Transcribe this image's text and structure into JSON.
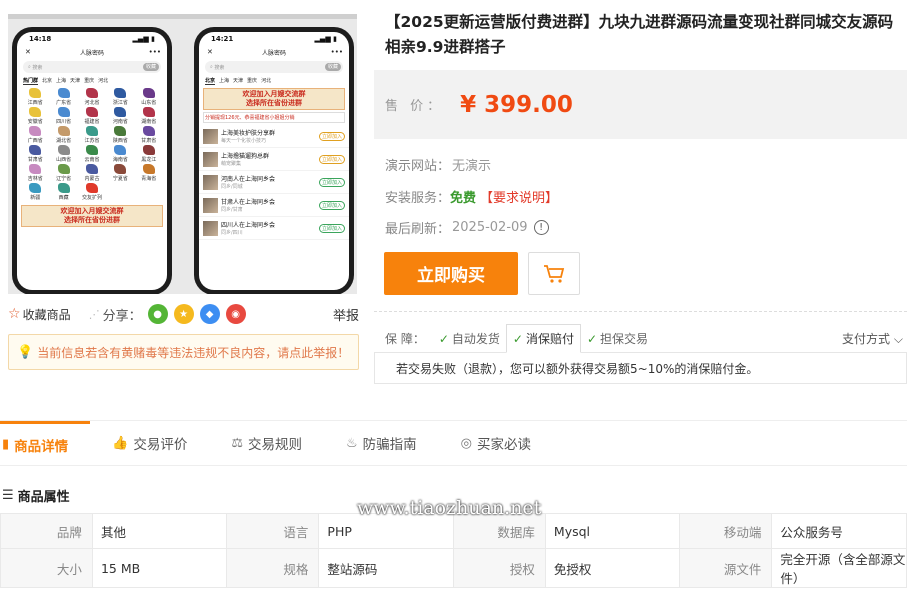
{
  "product": {
    "title": "【2025更新运营版付费进群】九块九进群源码流量变现社群同城交友源码相亲9.9进群搭子",
    "price_label": "售 价：",
    "price": "¥ 399.00",
    "demo_label": "演示网站：",
    "demo_value": "无演示",
    "install_label": "安装服务：",
    "install_value": "免费",
    "install_req": "【要求说明】",
    "refresh_label": "最后刷新：",
    "refresh_value": "2025-02-09",
    "info_icon_glyph": "!",
    "buy_label": "立即购买"
  },
  "gallery": {
    "phone1": {
      "time": "14:18",
      "title": "人脉密码",
      "search_placeholder": "搜索",
      "search_btn": "收藏",
      "cities": [
        "热门群",
        "北京",
        "上海",
        "天津",
        "重庆",
        "河北"
      ],
      "provinces": [
        {
          "name": "江西省",
          "color": "#e8c23a"
        },
        {
          "name": "广东省",
          "color": "#4a8ad0"
        },
        {
          "name": "河北省",
          "color": "#b2344a"
        },
        {
          "name": "浙江省",
          "color": "#2f5aa0"
        },
        {
          "name": "山东省",
          "color": "#6a3a8a"
        },
        {
          "name": "安徽省",
          "color": "#e8c23a"
        },
        {
          "name": "四川省",
          "color": "#4a8ad0"
        },
        {
          "name": "福建省",
          "color": "#b2344a"
        },
        {
          "name": "河南省",
          "color": "#2f5aa0"
        },
        {
          "name": "湖南省",
          "color": "#b2344a"
        },
        {
          "name": "广西省",
          "color": "#c78ac0"
        },
        {
          "name": "湖北省",
          "color": "#c49a6a"
        },
        {
          "name": "江苏省",
          "color": "#3a9a8a"
        },
        {
          "name": "陕西省",
          "color": "#4a7a3a"
        },
        {
          "name": "甘肃省",
          "color": "#6a4aa0"
        },
        {
          "name": "甘肃省",
          "color": "#4a5aa0"
        },
        {
          "name": "山西省",
          "color": "#8a8a8a"
        },
        {
          "name": "云南省",
          "color": "#3a8a4a"
        },
        {
          "name": "海南省",
          "color": "#4a8ad0"
        },
        {
          "name": "黑龙江",
          "color": "#8a3a3a"
        },
        {
          "name": "吉林省",
          "color": "#c78ac0"
        },
        {
          "name": "辽宁省",
          "color": "#6a9a4a"
        },
        {
          "name": "内蒙古",
          "color": "#4a5aa0"
        },
        {
          "name": "宁夏省",
          "color": "#8a4a3a"
        },
        {
          "name": "青海省",
          "color": "#c7782a"
        },
        {
          "name": "新疆",
          "color": "#3a9ac0"
        },
        {
          "name": "西藏",
          "color": "#3a9a8a"
        },
        {
          "name": "交友扩列",
          "color": "#e0392a"
        }
      ],
      "banner": "欢迎加入月嫂交流群\n选择所在省份进群"
    },
    "phone2": {
      "time": "14:21",
      "title": "人脉密码",
      "search_placeholder": "搜索",
      "search_btn": "收藏",
      "cities": [
        "北京",
        "上海",
        "天津",
        "重庆",
        "河北"
      ],
      "banner": "欢迎加入月嫂交流群\n选择所在省份进群",
      "banner2": "分销提现126元、恭喜福建省小姐姐分销",
      "groups": [
        {
          "title": "上海美妆护肤分享群",
          "sub": "每天一个化妆小技巧",
          "btn": "立即加入",
          "yellow": true
        },
        {
          "title": "上海撸猫遛狗总群",
          "sub": "萌宠聚集",
          "btn": "立即加入",
          "yellow": true
        },
        {
          "title": "河南人在上海同乡会",
          "sub": "同乡/同城",
          "btn": "立即加入",
          "yellow": false
        },
        {
          "title": "甘肃人在上海同乡会",
          "sub": "同乡/甘肃",
          "btn": "立即加入",
          "yellow": false
        },
        {
          "title": "四川人在上海同乡会",
          "sub": "同乡/四川",
          "btn": "立即加入",
          "yellow": false
        }
      ]
    }
  },
  "favbar": {
    "fav_label": "收藏商品",
    "share_label": "分享：",
    "report_label": "举报",
    "share_targets": [
      {
        "name": "wechat-share-icon",
        "color": "#54b536",
        "glyph": "●"
      },
      {
        "name": "qzone-share-icon",
        "color": "#f5b91e",
        "glyph": "★"
      },
      {
        "name": "qq-share-icon",
        "color": "#3d8ef2",
        "glyph": "◆"
      },
      {
        "name": "weibo-share-icon",
        "color": "#e8493f",
        "glyph": "◉"
      }
    ]
  },
  "warning": "当前信息若含有黄赌毒等违法违规不良内容，请点此举报！",
  "guarantee": {
    "label": "保  障：",
    "items": [
      "自动发货",
      "消保赔付",
      "担保交易"
    ],
    "pay_label": "支付方式",
    "note": "若交易失败（退款），您可以额外获得交易额5~10%的消保赔付金。"
  },
  "tabs": [
    "商品详情",
    "交易评价",
    "交易规则",
    "防骗指南",
    "买家必读"
  ],
  "attributes": {
    "heading": "商品属性",
    "watermark": "www.tiaozhuan.net",
    "rows": [
      [
        [
          "品牌",
          "其他"
        ],
        [
          "语言",
          "PHP"
        ],
        [
          "数据库",
          "Mysql"
        ],
        [
          "移动端",
          "公众服务号"
        ]
      ],
      [
        [
          "大小",
          "15 MB"
        ],
        [
          "规格",
          "整站源码"
        ],
        [
          "授权",
          "免授权"
        ],
        [
          "源文件",
          "完全开源（含全部源文件）"
        ]
      ]
    ]
  }
}
